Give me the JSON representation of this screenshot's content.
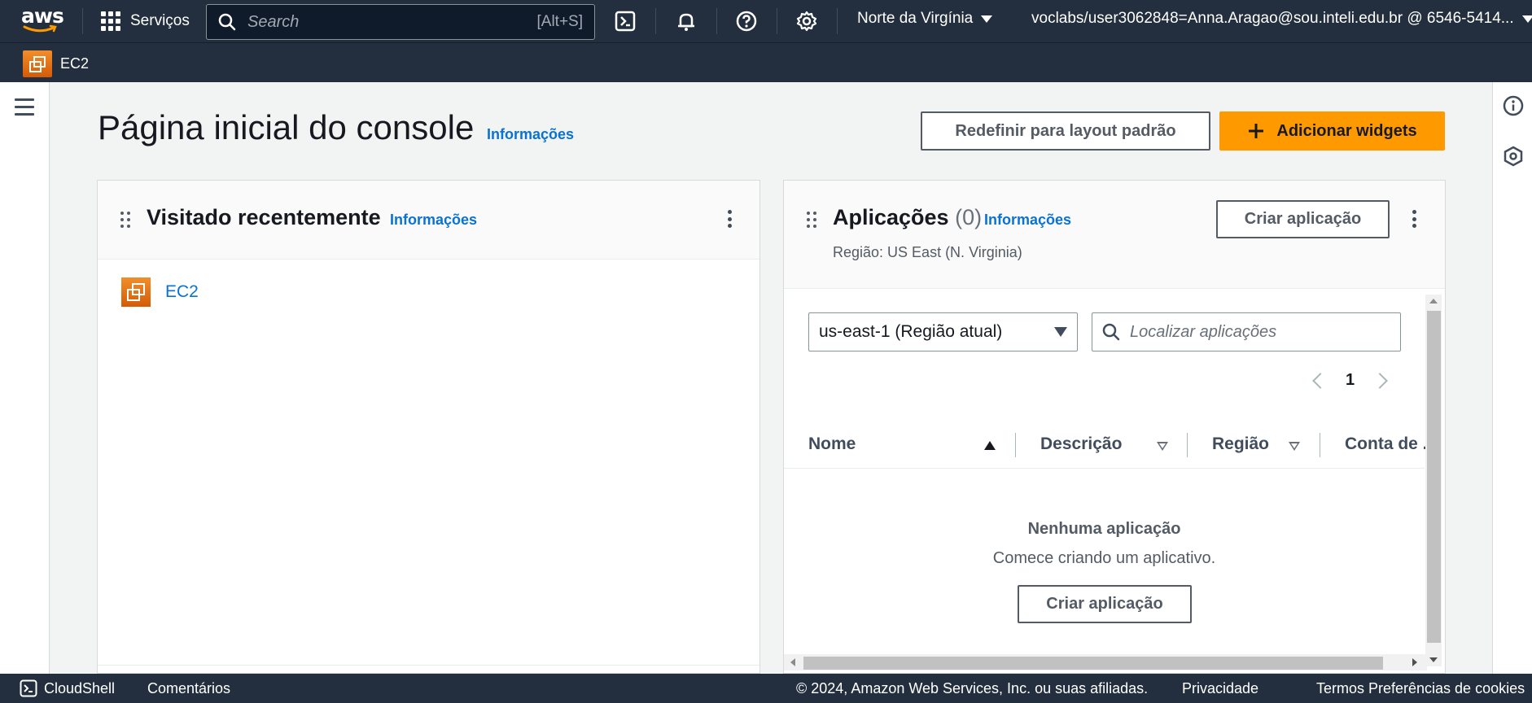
{
  "topnav": {
    "logo_text": "aws",
    "services_label": "Serviços",
    "search_placeholder": "Search",
    "search_shortcut": "[Alt+S]",
    "region_label": "Norte da Virgínia",
    "account_label": "voclabs/user3062848=Anna.Aragao@sou.inteli.edu.br @ 6546-5414..."
  },
  "subnav": {
    "favorite_label": "EC2"
  },
  "page": {
    "title": "Página inicial do console",
    "info_label": "Informações",
    "reset_button": "Redefinir para layout padrão",
    "add_widgets_button": "Adicionar widgets"
  },
  "recent_widget": {
    "title": "Visitado recentemente",
    "info_label": "Informações",
    "items": [
      {
        "label": "EC2"
      }
    ]
  },
  "apps_widget": {
    "title": "Aplicações",
    "count": "(0)",
    "info_label": "Informações",
    "region_text": "Região: US East (N. Virginia)",
    "create_button": "Criar aplicação",
    "region_select": "us-east-1 (Região atual)",
    "find_placeholder": "Localizar aplicações",
    "current_page": "1",
    "columns": [
      "Nome",
      "Descrição",
      "Região",
      "Conta de ..."
    ],
    "empty_title": "Nenhuma aplicação",
    "empty_subtitle": "Comece criando um aplicativo.",
    "empty_button": "Criar aplicação"
  },
  "footer": {
    "cloudshell": "CloudShell",
    "feedback": "Comentários",
    "copyright": "© 2024, Amazon Web Services, Inc. ou suas afiliadas.",
    "privacy": "Privacidade",
    "terms": "Termos",
    "cookies": "Preferências de cookies"
  },
  "colors": {
    "nav_bg": "#232f3e",
    "accent_orange": "#ff9900",
    "link_blue": "#0972d3",
    "page_bg": "#f2f3f3"
  }
}
